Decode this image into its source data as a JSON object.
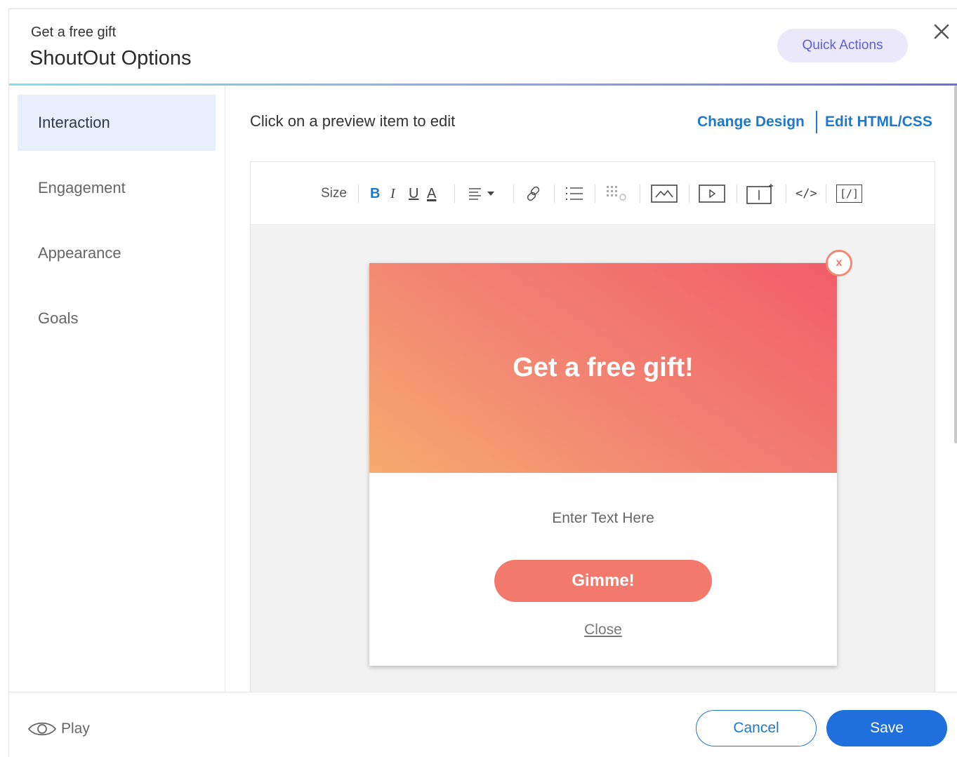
{
  "header": {
    "subtitle": "Get a free gift",
    "title": "ShoutOut Options",
    "quick_actions_label": "Quick Actions",
    "close_icon": "close-icon"
  },
  "sidebar": {
    "items": [
      {
        "label": "Interaction",
        "active": true
      },
      {
        "label": "Engagement",
        "active": false
      },
      {
        "label": "Appearance",
        "active": false
      },
      {
        "label": "Goals",
        "active": false
      }
    ]
  },
  "main": {
    "hint": "Click on a preview item to edit",
    "change_design": "Change Design",
    "edit_html_css": "Edit HTML/CSS"
  },
  "toolbar": {
    "size_label": "Size",
    "bold": "B",
    "italic": "I",
    "underline": "U",
    "font_color": "A",
    "code_label": "</>",
    "shortcode_label": "[/]"
  },
  "popup": {
    "heading": "Get a free gift!",
    "close_glyph": "x",
    "body_text": "Enter Text Here",
    "cta_label": "Gimme!",
    "close_link": "Close",
    "gradient_start": "#f6ab6e",
    "gradient_end": "#f25d6b",
    "cta_color": "#f2796b"
  },
  "footer": {
    "play_label": "Play",
    "cancel_label": "Cancel",
    "save_label": "Save"
  },
  "colors": {
    "accent_blue": "#1f78c8",
    "save_blue": "#1f6fdc",
    "quick_actions_bg": "#ece8fb",
    "sidebar_active_bg": "#e7effb"
  }
}
